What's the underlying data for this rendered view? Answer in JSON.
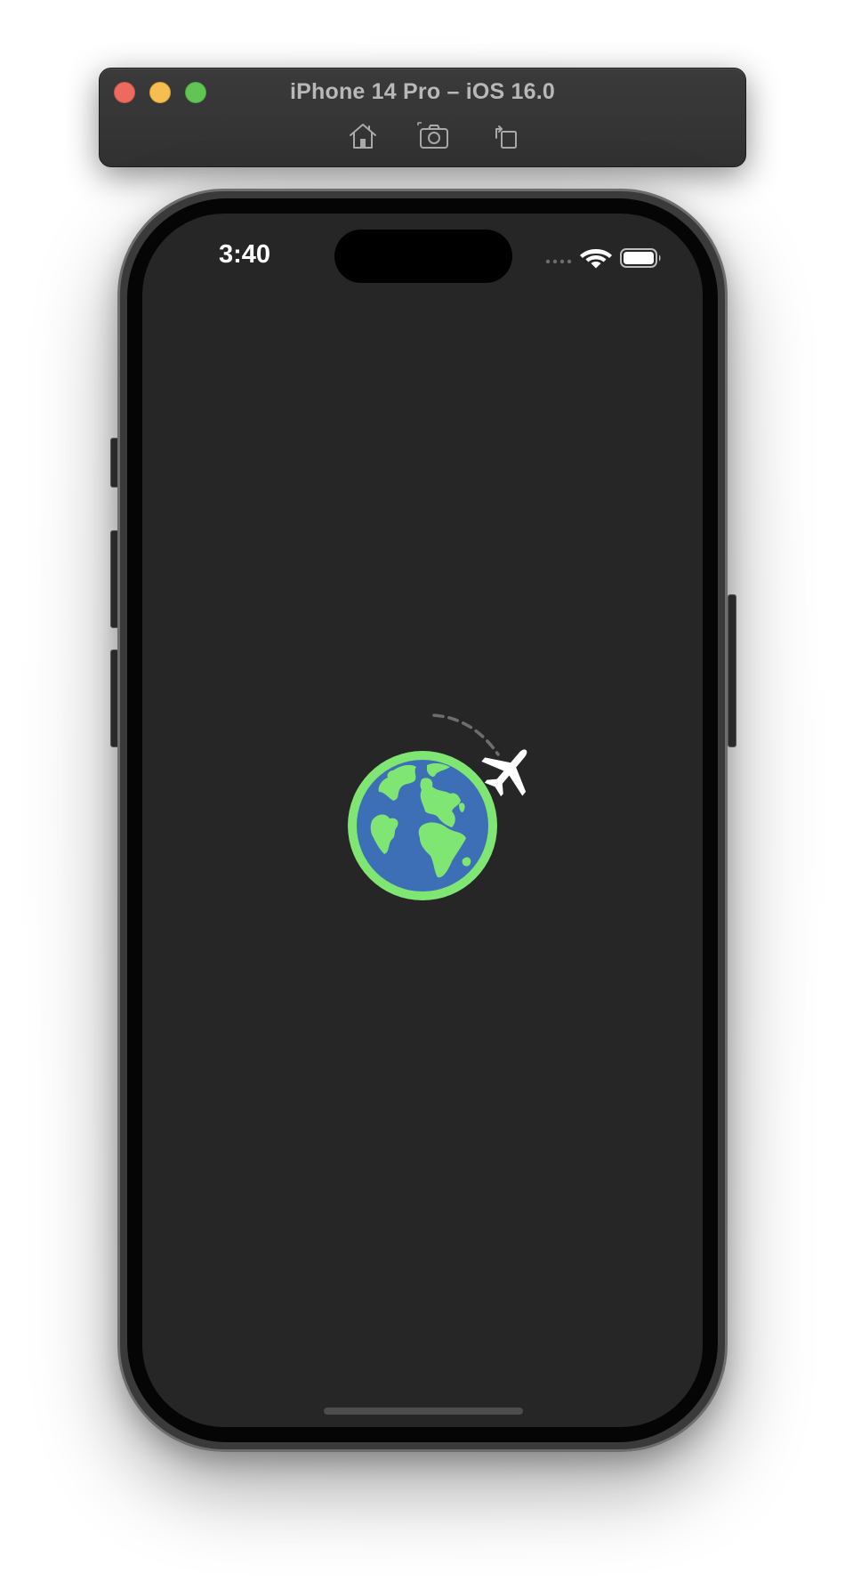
{
  "simulator": {
    "title": "iPhone 14 Pro – iOS 16.0",
    "traffic_lights": {
      "close_color": "#ec6a5e",
      "minimize_color": "#f4bf4f",
      "maximize_color": "#61c554"
    },
    "toolbar_icons": [
      "home-icon",
      "screenshot-icon",
      "rotate-icon"
    ]
  },
  "device": {
    "status_bar": {
      "time": "3:40",
      "icons": [
        "signal-icon",
        "wifi-icon",
        "battery-icon"
      ]
    },
    "screen_background": "#262626"
  },
  "app": {
    "splash_icon": "globe-airplane-icon",
    "colors": {
      "globe_ocean": "#3d6fb6",
      "globe_land": "#7fe673",
      "airplane": "#ffffff",
      "flight_path": "#7a7a7a"
    }
  }
}
